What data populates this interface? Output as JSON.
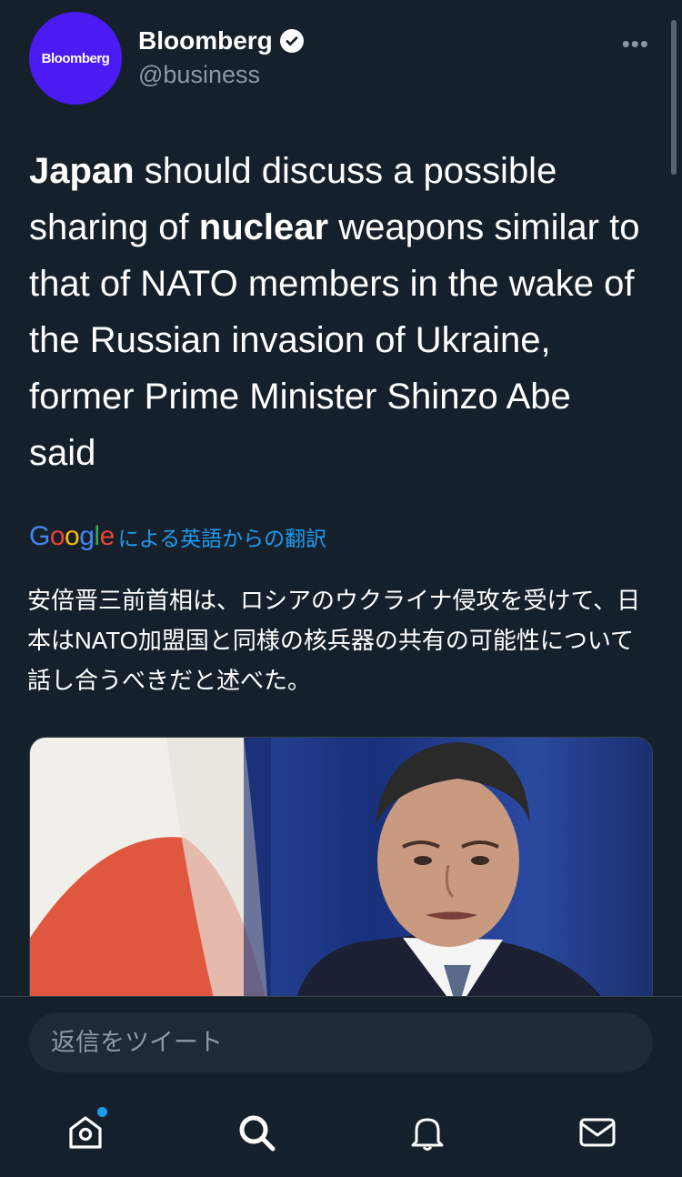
{
  "author": {
    "avatar_text": "Bloomberg",
    "name": "Bloomberg",
    "handle": "@business",
    "avatar_color": "#4a1bf3"
  },
  "more_label": "•••",
  "tweet": {
    "part1_bold": "Japan",
    "part2": " should discuss a possible sharing of ",
    "part3_bold": "nuclear",
    "part4": " weapons similar to that of NATO members in the wake of the Russian invasion of Ukraine, former Prime Minister Shinzo Abe said"
  },
  "translate": {
    "logo_letters": [
      "G",
      "o",
      "o",
      "g",
      "l",
      "e"
    ],
    "label": "による英語からの翻訳"
  },
  "translation_text": "安倍晋三前首相は、ロシアのウクライナ侵攻を受けて、日本はNATO加盟国と同様の核兵器の共有の可能性について話し合うべきだと述べた。",
  "composer": {
    "placeholder": "返信をツイート"
  },
  "tabs": [
    {
      "name": "home",
      "icon": "home-icon",
      "badge": true
    },
    {
      "name": "search",
      "icon": "search-icon",
      "badge": false
    },
    {
      "name": "notifications",
      "icon": "bell-icon",
      "badge": false
    },
    {
      "name": "messages",
      "icon": "mail-icon",
      "badge": false
    }
  ],
  "colors": {
    "background": "#15202b",
    "accent": "#1d9bf0",
    "secondary_text": "#8b98a5"
  }
}
